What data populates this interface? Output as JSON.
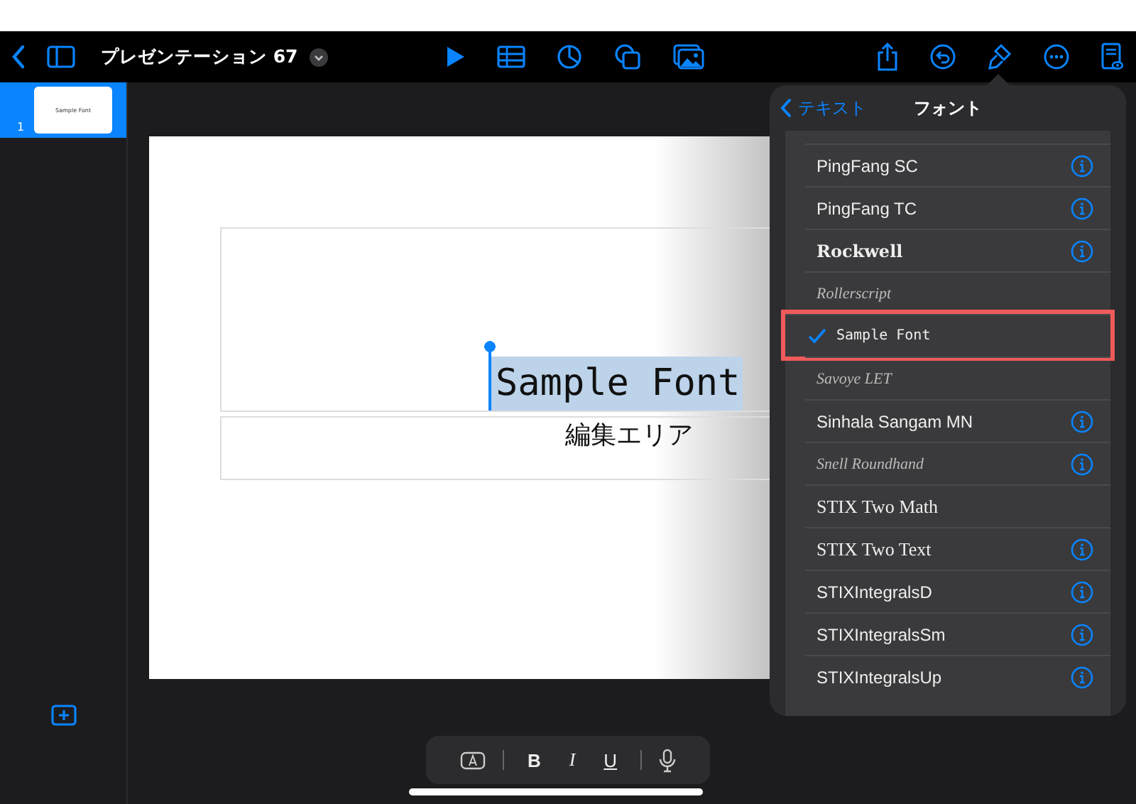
{
  "toolbar": {
    "title": "プレゼンテーション 67"
  },
  "slides": [
    {
      "number": "1",
      "selected": true,
      "thumbnail_text": "Sample Font"
    }
  ],
  "slide": {
    "title_text": "Sample Font",
    "title_selected": true,
    "body_text": "編集エリア"
  },
  "popover": {
    "back_label": "テキスト",
    "title": "フォント",
    "fonts": [
      {
        "name": "PingFang SC",
        "kind": "sans",
        "selected": false,
        "info": true
      },
      {
        "name": "PingFang TC",
        "kind": "sans",
        "selected": false,
        "info": true
      },
      {
        "name": "Rockwell",
        "kind": "slab",
        "selected": false,
        "info": true
      },
      {
        "name": "Rollerscript",
        "kind": "script",
        "selected": false,
        "info": false
      },
      {
        "name": "Sample Font",
        "kind": "hand",
        "selected": true,
        "info": false
      },
      {
        "name": "Savoye LET",
        "kind": "script",
        "selected": false,
        "info": false
      },
      {
        "name": "Sinhala Sangam MN",
        "kind": "sans",
        "selected": false,
        "info": true
      },
      {
        "name": "Snell Roundhand",
        "kind": "script",
        "selected": false,
        "info": true
      },
      {
        "name": "STIX Two Math",
        "kind": "serif",
        "selected": false,
        "info": false
      },
      {
        "name": "STIX Two Text",
        "kind": "serif",
        "selected": false,
        "info": true
      },
      {
        "name": "STIXIntegralsD",
        "kind": "sans",
        "selected": false,
        "info": true
      },
      {
        "name": "STIXIntegralsSm",
        "kind": "sans",
        "selected": false,
        "info": true
      },
      {
        "name": "STIXIntegralsUp",
        "kind": "sans",
        "selected": false,
        "info": true
      }
    ]
  },
  "format_bar": {
    "bold": "B",
    "italic": "I",
    "underline": "U"
  }
}
